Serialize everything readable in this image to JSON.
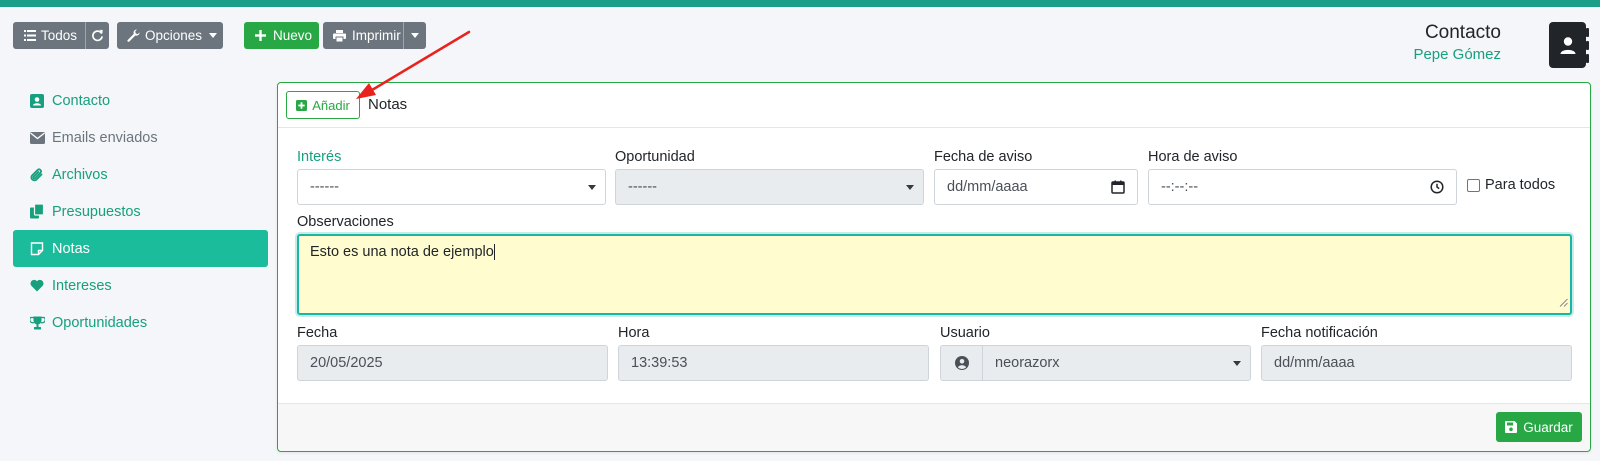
{
  "colors": {
    "accent": "#1abc9c",
    "accent_text": "#17a07e",
    "success": "#28a745",
    "secondary": "#6c757d",
    "highlight_field": "#fffdd0",
    "annotation_arrow": "#e8231e"
  },
  "toolbar": {
    "all_label": "Todos",
    "all_icon": "list-icon",
    "refresh_icon": "refresh-icon",
    "options_label": "Opciones",
    "options_icon": "wrench-icon",
    "new_label": "Nuevo",
    "new_icon": "plus-icon",
    "print_label": "Imprimir",
    "print_icon": "printer-icon"
  },
  "header": {
    "title": "Contacto",
    "subtitle": "Pepe Gómez",
    "avatar_icon": "contact-book-icon"
  },
  "sidebar": {
    "items": [
      {
        "label": "Contacto",
        "icon": "contact-card-icon",
        "active": false
      },
      {
        "label": "Emails enviados",
        "icon": "envelope-icon",
        "active": false
      },
      {
        "label": "Archivos",
        "icon": "paperclip-icon",
        "active": false
      },
      {
        "label": "Presupuestos",
        "icon": "copy-icon",
        "active": false
      },
      {
        "label": "Notas",
        "icon": "note-icon",
        "active": true
      },
      {
        "label": "Intereses",
        "icon": "heart-icon",
        "active": false
      },
      {
        "label": "Oportunidades",
        "icon": "trophy-icon",
        "active": false
      }
    ]
  },
  "card": {
    "add_label": "Añadir",
    "title": "Notas",
    "save_label": "Guardar"
  },
  "form": {
    "interest": {
      "label": "Interés",
      "value": "------"
    },
    "opportunity": {
      "label": "Oportunidad",
      "value": "------"
    },
    "notice_date": {
      "label": "Fecha de aviso",
      "placeholder": "dd/mm/aaaa"
    },
    "notice_time": {
      "label": "Hora de aviso",
      "placeholder": "--:--:--"
    },
    "for_all": {
      "label": "Para todos",
      "checked": false
    },
    "observations": {
      "label": "Observaciones",
      "value": "Esto es una nota de ejemplo"
    },
    "date": {
      "label": "Fecha",
      "value": "20/05/2025"
    },
    "time": {
      "label": "Hora",
      "value": "13:39:53"
    },
    "user": {
      "label": "Usuario",
      "value": "neorazorx"
    },
    "notification_date": {
      "label": "Fecha notificación",
      "placeholder": "dd/mm/aaaa"
    }
  }
}
